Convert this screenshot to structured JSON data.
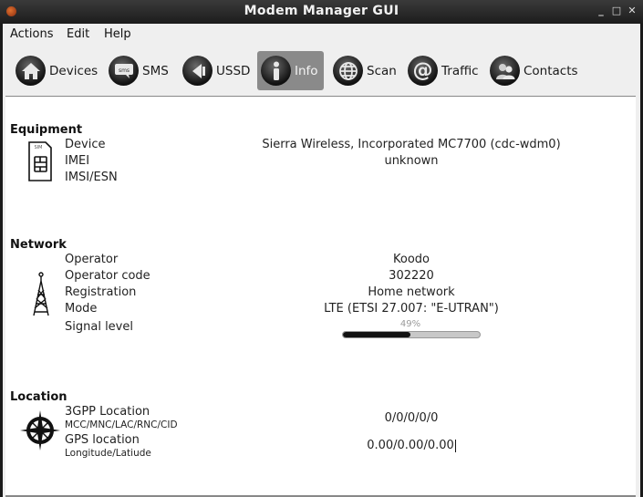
{
  "window": {
    "title": "Modem Manager GUI"
  },
  "menubar": {
    "items": [
      "Actions",
      "Edit",
      "Help"
    ]
  },
  "toolbar": {
    "active": "Info",
    "buttons": [
      {
        "label": "Devices",
        "icon": "home-icon"
      },
      {
        "label": "SMS",
        "icon": "sms-icon"
      },
      {
        "label": "USSD",
        "icon": "ussd-icon"
      },
      {
        "label": "Info",
        "icon": "info-icon"
      },
      {
        "label": "Scan",
        "icon": "globe-icon"
      },
      {
        "label": "Traffic",
        "icon": "at-icon"
      },
      {
        "label": "Contacts",
        "icon": "contacts-icon"
      }
    ]
  },
  "equipment": {
    "heading": "Equipment",
    "icon": "sim-card-icon",
    "fields": [
      {
        "label": "Device",
        "value": "Sierra Wireless, Incorporated MC7700 (cdc-wdm0)"
      },
      {
        "label": "IMEI",
        "value": "unknown"
      },
      {
        "label": "IMSI/ESN",
        "value": ""
      }
    ]
  },
  "network": {
    "heading": "Network",
    "icon": "antenna-tower-icon",
    "fields": [
      {
        "label": "Operator",
        "value": "Koodo"
      },
      {
        "label": "Operator code",
        "value": "302220"
      },
      {
        "label": "Registration",
        "value": "Home network"
      },
      {
        "label": "Mode",
        "value": "LTE (ETSI 27.007: \"E-UTRAN\")"
      },
      {
        "label": "Signal level",
        "value": "49%",
        "percent": 49
      }
    ]
  },
  "location": {
    "heading": "Location",
    "icon": "compass-icon",
    "fields": [
      {
        "label": "3GPP Location",
        "sublabel": "MCC/MNC/LAC/RNC/CID",
        "value": "0/0/0/0/0"
      },
      {
        "label": "GPS location",
        "sublabel": "Longitude/Latiude",
        "value": "0.00/0.00/0.00"
      }
    ]
  }
}
